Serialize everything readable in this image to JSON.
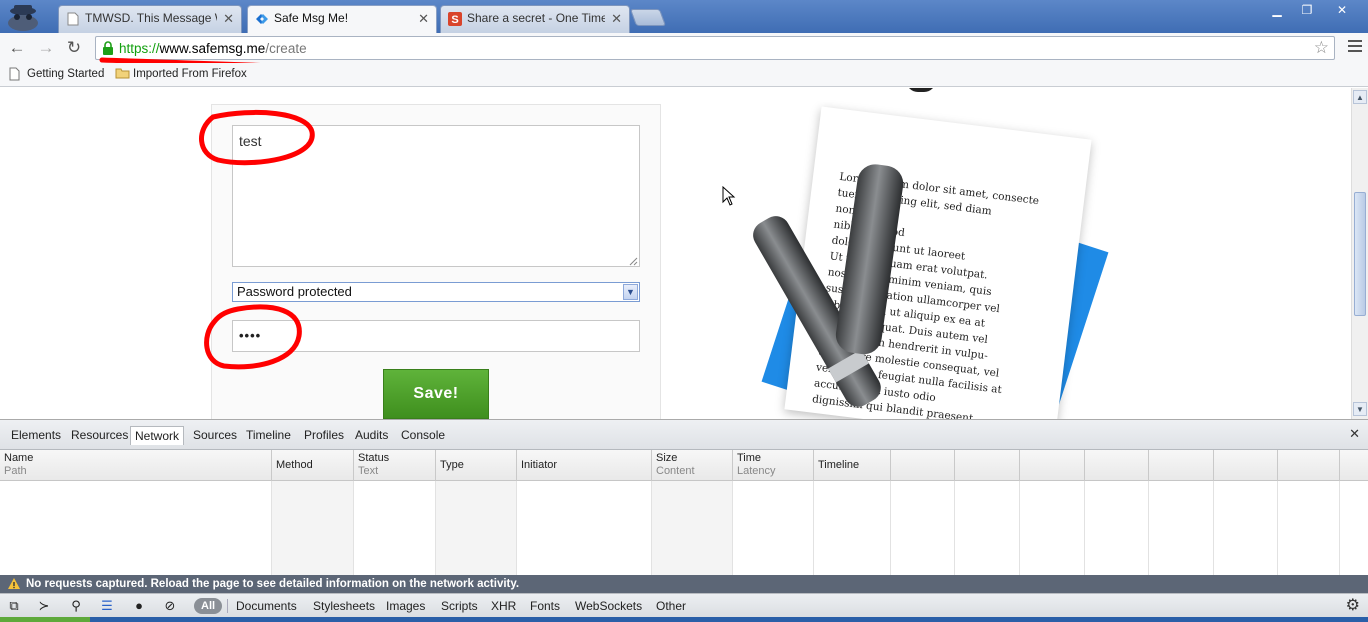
{
  "browser": {
    "tabs": [
      {
        "title": "TMWSD. This Message Will Se",
        "active": false
      },
      {
        "title": "Safe Msg Me!",
        "active": true
      },
      {
        "title": "Share a secret - One Time",
        "active": false
      }
    ],
    "url": {
      "scheme": "https://",
      "host": "www.safemsg.me",
      "path": "/create"
    },
    "bookmarks": [
      {
        "label": "Getting Started"
      },
      {
        "label": "Imported From Firefox"
      }
    ]
  },
  "form": {
    "message_value": "test",
    "protection_selected": "Password protected",
    "password_mask": "••••",
    "save_label": "Save!"
  },
  "illustration": {
    "lorem_lines": [
      "Lorem ipsum dolor sit amet, consecte",
      "tuer adipiscing elit, sed diam",
      "nonummy",
      "nibh euismod",
      "dolor tincidunt ut laoreet",
      "Ut wisi  aliquam erat volutpat.",
      "nostrud  ad minim veniam, quis",
      "suscipit  ci tation ullamcorper vel",
      "lobortis nisl ut aliquip ex ea at",
      "eum  consequat. Duis autem vel",
      "tate  dolor in hendrerit in vulpu-",
      "um dolore  molestie consequat, vel",
      "veros et  eu feugiat nulla facilisis at",
      "accumsan et iusto odio",
      "dignissim qui blandit praesent"
    ]
  },
  "devtools": {
    "tabs": [
      "Elements",
      "Resources",
      "Network",
      "Sources",
      "Timeline",
      "Profiles",
      "Audits",
      "Console"
    ],
    "active_tab": "Network",
    "columns": [
      {
        "main": "Name",
        "sub": "Path"
      },
      {
        "main": "Method",
        "sub": ""
      },
      {
        "main": "Status",
        "sub": "Text"
      },
      {
        "main": "Type",
        "sub": ""
      },
      {
        "main": "Initiator",
        "sub": ""
      },
      {
        "main": "Size",
        "sub": "Content"
      },
      {
        "main": "Time",
        "sub": "Latency"
      },
      {
        "main": "Timeline",
        "sub": ""
      }
    ],
    "status_message": "No requests captured. Reload the page to see detailed information on the network activity.",
    "filters": {
      "all_label": "All",
      "items": [
        "Documents",
        "Stylesheets",
        "Images",
        "Scripts",
        "XHR",
        "Fonts",
        "WebSockets",
        "Other"
      ]
    }
  },
  "colors": {
    "save_button": "#4f9f2c",
    "annotation_red": "#ff0000",
    "https_green": "#13a00f",
    "chrome_blue": "#3f6db4"
  }
}
